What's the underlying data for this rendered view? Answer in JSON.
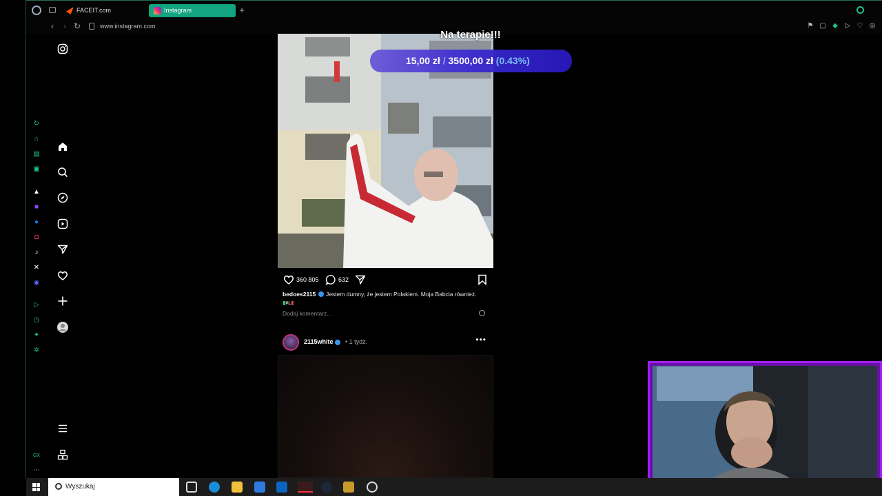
{
  "browser": {
    "tabs": [
      {
        "label": "FACEIT.com",
        "active": false
      },
      {
        "label": "Instagram",
        "active": true
      }
    ],
    "url": "www.instagram.com",
    "accent_color": "#12a57f"
  },
  "post": {
    "likes": "360 805",
    "comments": "632",
    "username": "bedoes2115",
    "caption": "Jestem dumny, że jestem Polakiem. Moja Babcia również.",
    "caption_line2": "PL",
    "comment_placeholder": "Dodaj komentarz..."
  },
  "post2": {
    "username": "2115white",
    "time": "• 1 tydz."
  },
  "overlay": {
    "title": "Na terapie!!!",
    "current": "15,00 zł",
    "separator": "/",
    "goal": "3500,00 zł",
    "percent": "(0.43%)",
    "progress_fraction": 0.0043
  },
  "taskbar": {
    "search_placeholder": "Wyszukaj"
  },
  "opera_sidebar": {
    "bottom_label": "GX"
  }
}
